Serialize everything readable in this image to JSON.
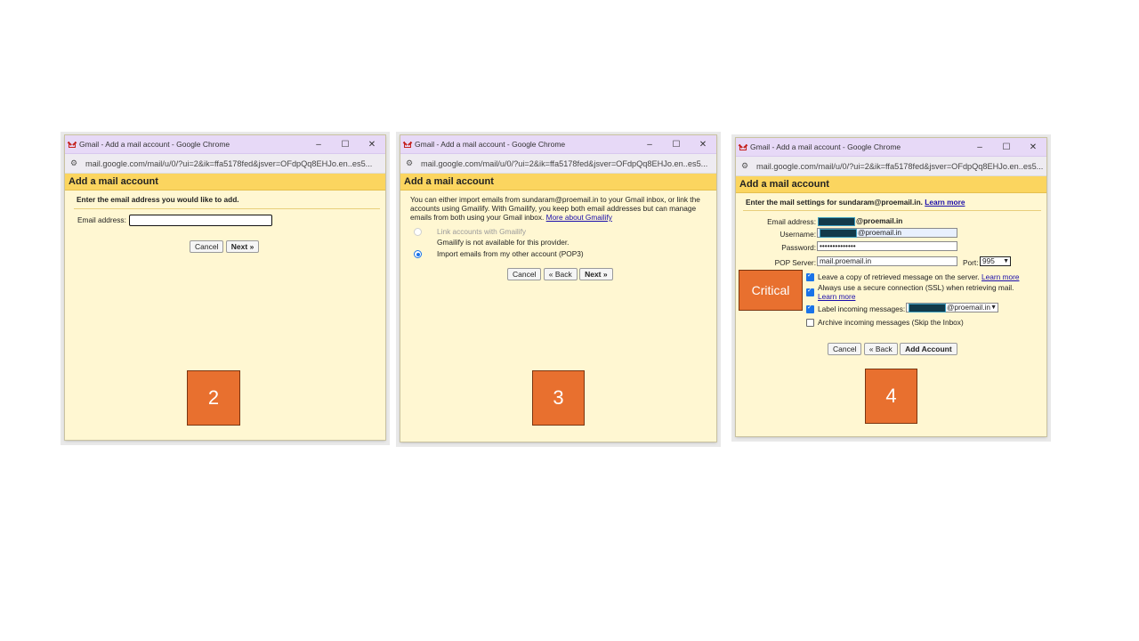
{
  "colors": {
    "title_bar": "#e7d9f7",
    "header": "#fbd55f",
    "panel": "#fff7d2",
    "badge": "#e8702f",
    "redacted": "#123a4a"
  },
  "shared": {
    "window_title": "Gmail - Add a mail account - Google Chrome",
    "url": "mail.google.com/mail/u/0/?ui=2&ik=ffa5178fed&jsver=OFdpQq8EHJo.en..es5...",
    "minimize": "–",
    "maximize": "☐",
    "close": "✕",
    "header": "Add a mail account"
  },
  "panel1": {
    "instruction": "Enter the email address you would like to add.",
    "email_label": "Email address:",
    "email_value": "",
    "cancel": "Cancel",
    "next": "Next »",
    "step": "2"
  },
  "panel2": {
    "info_text": "You can either import emails from sundaram@proemail.in to your Gmail inbox, or link the accounts using Gmailify. With Gmailify, you keep both email addresses but can manage emails from both using your Gmail inbox.",
    "more_link": "More about Gmailify",
    "option1": "Link accounts with Gmailify",
    "option1_note": "Gmailify is not available for this provider.",
    "option2": "Import emails from my other account (POP3)",
    "cancel": "Cancel",
    "back": "« Back",
    "next": "Next »",
    "step": "3"
  },
  "panel3": {
    "instruction": "Enter the mail settings for sundaram@proemail.in.",
    "learn_more": "Learn more",
    "email_label": "Email address:",
    "email_suffix": "@proemail.in",
    "username_label": "Username:",
    "username_suffix": "@proemail.in",
    "password_label": "Password:",
    "password_value": "••••••••••••••",
    "pop_label": "POP Server:",
    "pop_value": "mail.proemail.in",
    "port_label": "Port:",
    "port_value": "995",
    "opt_leave_copy": "Leave a copy of retrieved message on the server.",
    "opt_leave_copy_link": "Learn more",
    "opt_ssl": "Always use a secure connection (SSL) when retrieving mail.",
    "opt_ssl_link": "Learn more",
    "opt_label": "Label incoming messages:",
    "opt_label_value": "@proemail.in",
    "opt_archive": "Archive incoming messages (Skip the Inbox)",
    "cancel": "Cancel",
    "back": "« Back",
    "add": "Add Account",
    "critical": "Critical",
    "step": "4"
  }
}
